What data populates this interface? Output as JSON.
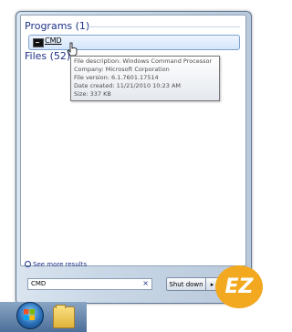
{
  "start_menu": {
    "programs_group": {
      "label": "Programs (1)"
    },
    "files_group": {
      "label": "Files (52)"
    },
    "results": [
      {
        "label": "CMD",
        "icon": "cmd-icon"
      }
    ],
    "tooltip": {
      "lines": [
        "File description: Windows Command Processor",
        "Company: Microsoft Corporation",
        "File version: 6.1.7601.17514",
        "Date created: 11/21/2010 10:23 AM",
        "Size: 337 KB"
      ]
    },
    "see_more_label": "See more results",
    "search": {
      "value": "CMD",
      "clear_glyph": "×"
    },
    "shutdown": {
      "label": "Shut down",
      "arrow": "▸"
    }
  },
  "taskbar": {
    "start_orb_icon": "windows-orb-icon",
    "pinned": [
      {
        "icon": "folder-icon"
      }
    ]
  },
  "watermark": {
    "text": "EZ"
  },
  "colors": {
    "group_header": "#1e3287",
    "highlight": "#d4e6fb",
    "logo": "#f2a81f"
  }
}
